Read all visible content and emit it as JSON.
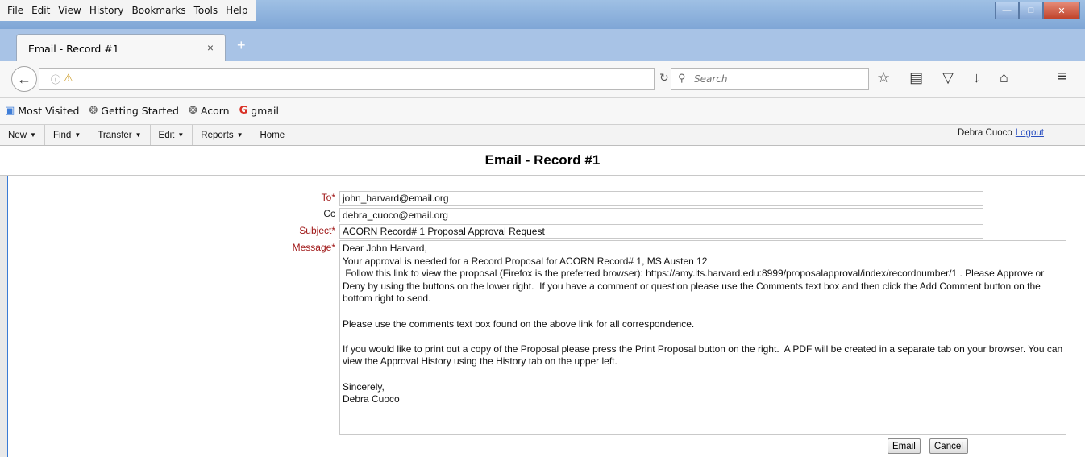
{
  "browser": {
    "menu": [
      "File",
      "Edit",
      "View",
      "History",
      "Bookmarks",
      "Tools",
      "Help"
    ],
    "tab_title": "Email - Record #1",
    "tab_close": "×",
    "new_tab": "+",
    "search_placeholder": "Search",
    "bookmarks": [
      {
        "label": "Most Visited",
        "icon": "most-visited-icon"
      },
      {
        "label": "Getting Started",
        "icon": "firefox-icon"
      },
      {
        "label": "Acorn",
        "icon": "firefox-icon"
      },
      {
        "label": "gmail",
        "icon": "google-icon"
      }
    ]
  },
  "app": {
    "menu": [
      "New",
      "Find",
      "Transfer",
      "Edit",
      "Reports",
      "Home"
    ],
    "user_name": "Debra Cuoco",
    "logout": "Logout",
    "page_title": "Email - Record #1"
  },
  "form": {
    "to_label": "To*",
    "to_value": "john_harvard@email.org",
    "cc_label": "Cc",
    "cc_value": "debra_cuoco@email.org",
    "subject_label": "Subject*",
    "subject_value": "ACORN Record# 1 Proposal Approval Request",
    "message_label": "Message*",
    "message_value": "Dear John Harvard,\nYour approval is needed for a Record Proposal for ACORN Record# 1, MS Austen 12\n Follow this link to view the proposal (Firefox is the preferred browser): https://amy.lts.harvard.edu:8999/proposalapproval/index/recordnumber/1 . Please Approve or Deny by using the buttons on the lower right.  If you have a comment or question please use the Comments text box and then click the Add Comment button on the bottom right to send.\n\nPlease use the comments text box found on the above link for all correspondence.\n\nIf you would like to print out a copy of the Proposal please press the Print Proposal button on the right.  A PDF will be created in a separate tab on your browser. You can view the Approval History using the History tab on the upper left.\n\nSincerely,\nDebra Cuoco",
    "email_button": "Email",
    "cancel_button": "Cancel"
  }
}
